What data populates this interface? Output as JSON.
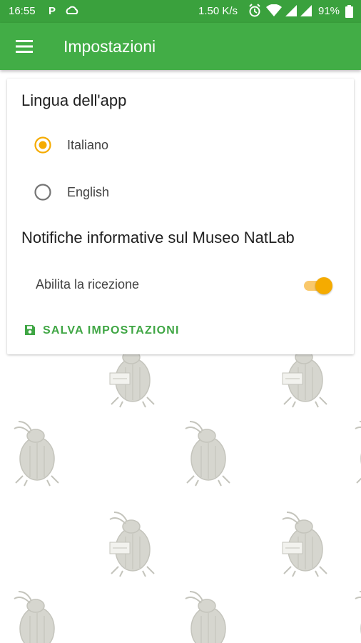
{
  "status_bar": {
    "time": "16:55",
    "p_icon": "P",
    "network_speed": "1.50 K/s",
    "battery_percent": "91%",
    "icons": [
      "p-icon",
      "cloud-icon",
      "alarm-icon",
      "wifi-icon",
      "signal-icon",
      "signal-icon",
      "battery-icon"
    ]
  },
  "app_bar": {
    "title": "Impostazioni",
    "menu_icon": "menu-icon"
  },
  "settings": {
    "language_heading": "Lingua dell'app",
    "languages": [
      {
        "label": "Italiano",
        "selected": true
      },
      {
        "label": "English",
        "selected": false
      }
    ],
    "notifications_heading": "Notifiche informative sul Museo NatLab",
    "notifications_toggle_label": "Abilita la ricezione",
    "notifications_enabled": true,
    "save_button_label": "SALVA IMPOSTAZIONI",
    "save_icon": "save-icon"
  },
  "colors": {
    "status_bar": "#3aa13d",
    "app_bar": "#42ad46",
    "accent": "#f5ab00",
    "save_text": "#3fa644",
    "mascot": "#cfcfc9"
  },
  "background": {
    "pattern_icon": "beetle-mascot-icon"
  }
}
